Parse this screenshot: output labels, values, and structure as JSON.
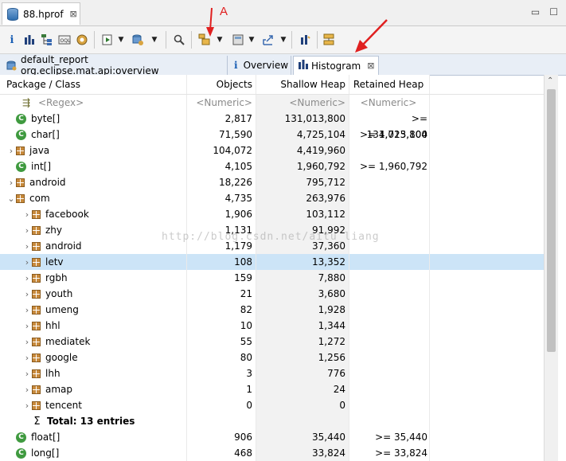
{
  "editor_tab": {
    "label": "88.hprof",
    "close": "⊠"
  },
  "window_controls": {
    "minimize": "▭",
    "maximize": "☐"
  },
  "toolbar": {
    "icons": [
      "info-icon",
      "histogram-icon",
      "dominator-tree-icon",
      "oql-icon",
      "thread-overview-icon",
      "run-report-icon",
      "query-browser-icon",
      "search-icon",
      "group-by-icon",
      "calculate-retained-icon",
      "export-icon",
      "pin-icon",
      "compare-icon"
    ]
  },
  "annotation": {
    "label": "A",
    "color": "#e02020"
  },
  "inner_tabs": [
    {
      "label": "default_report  org.eclipse.mat.api:overview"
    },
    {
      "label": "Overview"
    },
    {
      "label": "Histogram",
      "close": "⊠"
    }
  ],
  "table": {
    "headers": {
      "col1": "Package / Class",
      "col2": "Objects",
      "col3": "Shallow Heap",
      "col4": "Retained Heap"
    },
    "filters": {
      "col1": "<Regex>",
      "col2": "<Numeric>",
      "col3": "<Numeric>",
      "col4": "<Numeric>"
    },
    "rows": [
      {
        "type": "class",
        "level": 0,
        "expander": "",
        "name": "byte[]",
        "objects": "2,817",
        "shallow": "131,013,800",
        "retained": ">= 131,013,800"
      },
      {
        "type": "class",
        "level": 0,
        "expander": "",
        "name": "char[]",
        "objects": "71,590",
        "shallow": "4,725,104",
        "retained": ">= 4,725,104"
      },
      {
        "type": "pkg",
        "level": 0,
        "expander": "›",
        "name": "java",
        "objects": "104,072",
        "shallow": "4,419,960",
        "retained": ""
      },
      {
        "type": "class",
        "level": 0,
        "expander": "",
        "name": "int[]",
        "objects": "4,105",
        "shallow": "1,960,792",
        "retained": ">= 1,960,792"
      },
      {
        "type": "pkg",
        "level": 0,
        "expander": "›",
        "name": "android",
        "objects": "18,226",
        "shallow": "795,712",
        "retained": ""
      },
      {
        "type": "pkg",
        "level": 0,
        "expander": "⌄",
        "name": "com",
        "objects": "4,735",
        "shallow": "263,976",
        "retained": ""
      },
      {
        "type": "pkg",
        "level": 1,
        "expander": "›",
        "name": "facebook",
        "objects": "1,906",
        "shallow": "103,112",
        "retained": ""
      },
      {
        "type": "pkg",
        "level": 1,
        "expander": "›",
        "name": "zhy",
        "objects": "1,131",
        "shallow": "91,992",
        "retained": ""
      },
      {
        "type": "pkg",
        "level": 1,
        "expander": "›",
        "name": "android",
        "objects": "1,179",
        "shallow": "37,360",
        "retained": ""
      },
      {
        "type": "pkg",
        "level": 1,
        "expander": "›",
        "name": "letv",
        "objects": "108",
        "shallow": "13,352",
        "retained": "",
        "selected": true
      },
      {
        "type": "pkg",
        "level": 1,
        "expander": "›",
        "name": "rgbh",
        "objects": "159",
        "shallow": "7,880",
        "retained": ""
      },
      {
        "type": "pkg",
        "level": 1,
        "expander": "›",
        "name": "youth",
        "objects": "21",
        "shallow": "3,680",
        "retained": ""
      },
      {
        "type": "pkg",
        "level": 1,
        "expander": "›",
        "name": "umeng",
        "objects": "82",
        "shallow": "1,928",
        "retained": ""
      },
      {
        "type": "pkg",
        "level": 1,
        "expander": "›",
        "name": "hhl",
        "objects": "10",
        "shallow": "1,344",
        "retained": ""
      },
      {
        "type": "pkg",
        "level": 1,
        "expander": "›",
        "name": "mediatek",
        "objects": "55",
        "shallow": "1,272",
        "retained": ""
      },
      {
        "type": "pkg",
        "level": 1,
        "expander": "›",
        "name": "google",
        "objects": "80",
        "shallow": "1,256",
        "retained": ""
      },
      {
        "type": "pkg",
        "level": 1,
        "expander": "›",
        "name": "lhh",
        "objects": "3",
        "shallow": "776",
        "retained": ""
      },
      {
        "type": "pkg",
        "level": 1,
        "expander": "›",
        "name": "amap",
        "objects": "1",
        "shallow": "24",
        "retained": ""
      },
      {
        "type": "pkg",
        "level": 1,
        "expander": "›",
        "name": "tencent",
        "objects": "0",
        "shallow": "0",
        "retained": ""
      },
      {
        "type": "sum",
        "level": 1,
        "expander": "",
        "name": "Total: 13 entries",
        "objects": "",
        "shallow": "",
        "retained": ""
      },
      {
        "type": "class",
        "level": 0,
        "expander": "",
        "name": "float[]",
        "objects": "906",
        "shallow": "35,440",
        "retained": ">= 35,440"
      },
      {
        "type": "class",
        "level": 0,
        "expander": "",
        "name": "long[]",
        "objects": "468",
        "shallow": "33,824",
        "retained": ">= 33,824"
      }
    ]
  },
  "watermark": "http://blog.csdn.net/aitu_liang"
}
